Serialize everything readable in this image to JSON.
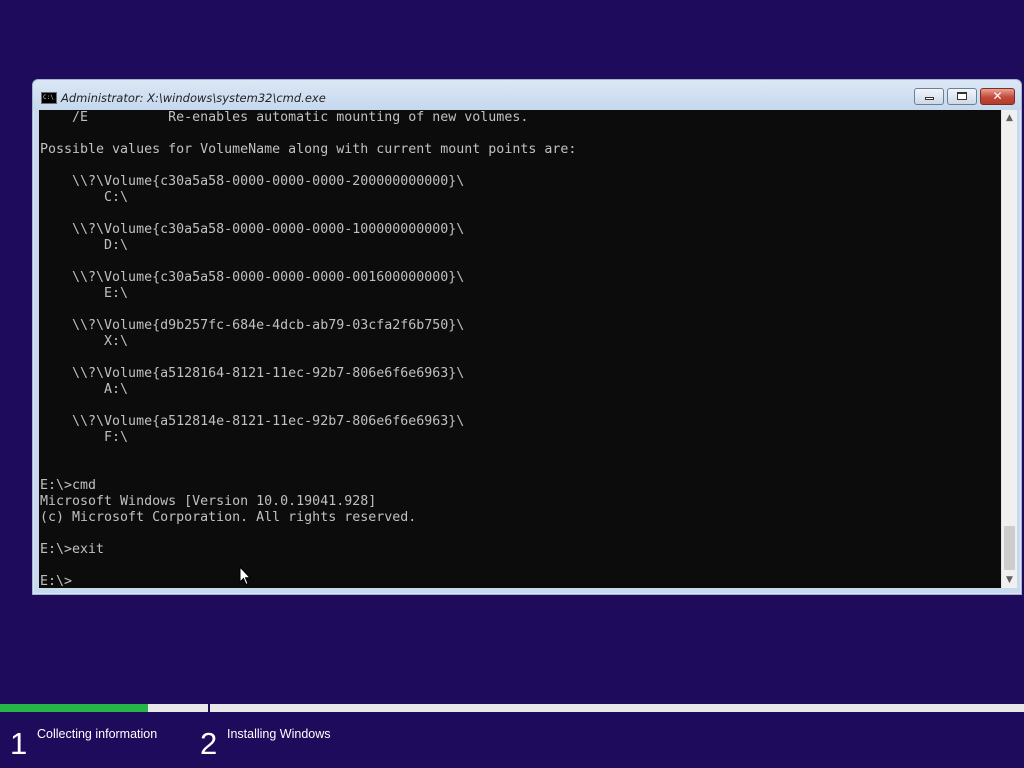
{
  "window": {
    "title": "Administrator: X:\\windows\\system32\\cmd.exe",
    "icon_text": "C:\\",
    "minimize_icon": "minimize-icon",
    "maximize_icon": "maximize-icon",
    "close_glyph": "✕"
  },
  "console": {
    "lines": [
      "    /E          Re-enables automatic mounting of new volumes.",
      "",
      "Possible values for VolumeName along with current mount points are:",
      "",
      "    \\\\?\\Volume{c30a5a58-0000-0000-0000-200000000000}\\",
      "        C:\\",
      "",
      "    \\\\?\\Volume{c30a5a58-0000-0000-0000-100000000000}\\",
      "        D:\\",
      "",
      "    \\\\?\\Volume{c30a5a58-0000-0000-0000-001600000000}\\",
      "        E:\\",
      "",
      "    \\\\?\\Volume{d9b257fc-684e-4dcb-ab79-03cfa2f6b750}\\",
      "        X:\\",
      "",
      "    \\\\?\\Volume{a5128164-8121-11ec-92b7-806e6f6e6963}\\",
      "        A:\\",
      "",
      "    \\\\?\\Volume{a512814e-8121-11ec-92b7-806e6f6e6963}\\",
      "        F:\\",
      "",
      "",
      "E:\\>cmd",
      "Microsoft Windows [Version 10.0.19041.928]",
      "(c) Microsoft Corporation. All rights reserved.",
      "",
      "E:\\>exit",
      "",
      "E:\\>"
    ],
    "text_color": "#c0c0c0",
    "background_color": "#0c0c0c"
  },
  "scrollbar": {
    "up_icon": "▲",
    "down_icon": "▼"
  },
  "setup": {
    "progress_fraction": 0.145,
    "progress_color": "#27b547",
    "background_color": "#1f0b5c",
    "steps": [
      {
        "number": "1",
        "label": "Collecting information"
      },
      {
        "number": "2",
        "label": "Installing Windows"
      }
    ]
  }
}
